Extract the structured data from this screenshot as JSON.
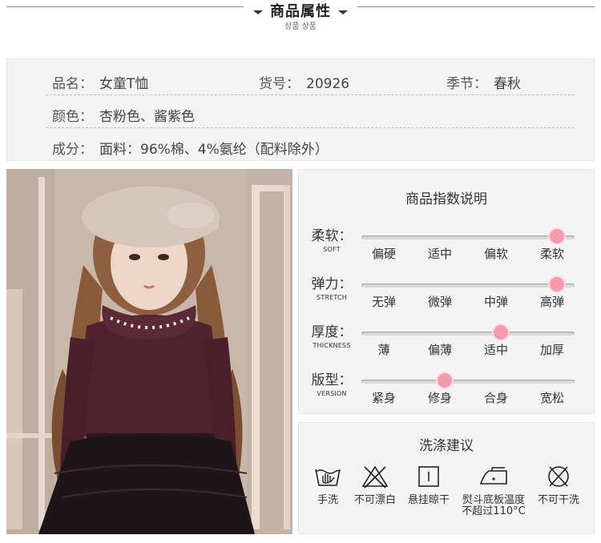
{
  "header": {
    "title": "商品属性",
    "subtitle": "상품 상품"
  },
  "attributes": {
    "row1": [
      {
        "key": "品名：",
        "value": "女童T恤"
      },
      {
        "key": "货号：",
        "value": "20926"
      },
      {
        "key": "季节：",
        "value": "春秋"
      }
    ],
    "row2": {
      "key": "颜色：",
      "value": "杏粉色、酱紫色"
    },
    "row3": {
      "key": "成分：",
      "value": "面料：96%棉、4%氨纶（配料除外）"
    }
  },
  "spec": {
    "title": "商品指数说明",
    "rows": [
      {
        "label": "柔软：",
        "en": "SOFT",
        "options": [
          "偏硬",
          "适中",
          "偏软",
          "柔软"
        ],
        "selected_index": 3
      },
      {
        "label": "弹力：",
        "en": "STRETCH",
        "options": [
          "无弹",
          "微弹",
          "中弹",
          "高弹"
        ],
        "selected_index": 3
      },
      {
        "label": "厚度：",
        "en": "THICKNESS",
        "options": [
          "薄",
          "偏薄",
          "适中",
          "加厚"
        ],
        "selected_index": 2
      },
      {
        "label": "版型：",
        "en": "VERSION",
        "options": [
          "紧身",
          "修身",
          "合身",
          "宽松"
        ],
        "selected_index": 1
      }
    ],
    "knob_color": "#f59aa8"
  },
  "wash": {
    "title": "洗涤建议",
    "items": [
      {
        "icon": "hand-wash-icon",
        "label": "手洗"
      },
      {
        "icon": "no-bleach-icon",
        "label": "不可漂白"
      },
      {
        "icon": "hang-dry-icon",
        "label": "悬挂晾干"
      },
      {
        "icon": "iron-icon",
        "label": "熨斗底板温度",
        "label2": "不超过110°C"
      },
      {
        "icon": "no-dry-clean-icon",
        "label": "不可干洗"
      }
    ]
  }
}
